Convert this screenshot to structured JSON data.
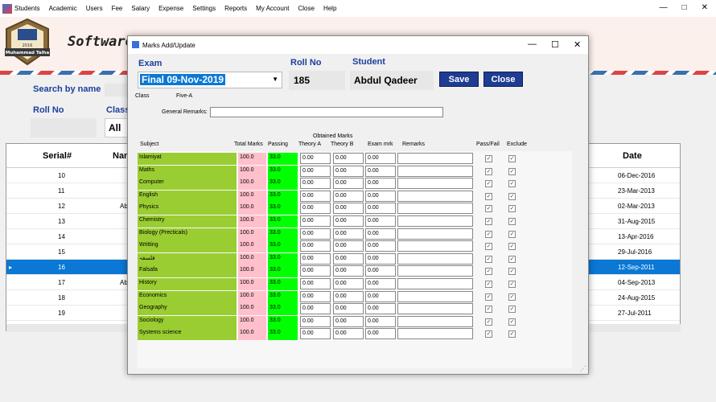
{
  "menu": [
    "Students",
    "Academic",
    "Users",
    "Fee",
    "Salary",
    "Expense",
    "Settings",
    "Reports",
    "My Account",
    "Close",
    "Help"
  ],
  "window_controls": [
    "—",
    "□",
    "✕"
  ],
  "banner": {
    "software_title": "Software",
    "logo_text": "Muhammad Talha",
    "logo_year": "2016"
  },
  "main": {
    "search_label": "Search by name",
    "roll_label": "Roll No",
    "class_label": "Class",
    "class_value": "All"
  },
  "grid": {
    "headers": {
      "serial": "Serial#",
      "name": "Nam",
      "date": "Date"
    },
    "rows": [
      {
        "serial": "10",
        "name": "",
        "date": "06-Dec-2016"
      },
      {
        "serial": "11",
        "name": "",
        "date": "23-Mar-2013"
      },
      {
        "serial": "12",
        "name": "Ab",
        "date": "02-Mar-2013"
      },
      {
        "serial": "13",
        "name": "",
        "date": "31-Aug-2015"
      },
      {
        "serial": "14",
        "name": "",
        "date": "13-Apr-2016"
      },
      {
        "serial": "15",
        "name": "",
        "date": "29-Jul-2016"
      },
      {
        "serial": "16",
        "name": "",
        "date": "12-Sep-2011"
      },
      {
        "serial": "17",
        "name": "Ab",
        "date": "04-Sep-2013"
      },
      {
        "serial": "18",
        "name": "",
        "date": "24-Aug-2015"
      },
      {
        "serial": "19",
        "name": "",
        "date": "27-Jul-2011"
      }
    ],
    "selected_index": 6,
    "selected_marker": "▸"
  },
  "dialog": {
    "title": "Marks Add/Update",
    "controls": [
      "—",
      "☐",
      "✕"
    ],
    "exam_label": "Exam",
    "exam_value": "Final 09-Nov-2019",
    "roll_label": "Roll No",
    "roll_value": "185",
    "student_label": "Student",
    "student_value": "Abdul Qadeer",
    "save_label": "Save",
    "close_label": "Close",
    "class_label": "Class",
    "class_value": "Five-A",
    "remarks_label": "General Remarks:",
    "headers": {
      "subject": "Subject",
      "total": "Total Marks",
      "passing": "Passing",
      "obtained": "Obtained Marks",
      "theory_a": "Theory A",
      "theory_b": "Theory B",
      "exam_mrk": "Exam mrk",
      "remarks": "Remarks",
      "pass_fail": "Pass/Fail",
      "exclude": "Exclude"
    },
    "subjects": [
      {
        "name": "Islamiyat",
        "total": "100.0",
        "passing": "33.0",
        "a": "0.00",
        "b": "0.00",
        "e": "0.00"
      },
      {
        "name": "Maths",
        "total": "100.0",
        "passing": "33.0",
        "a": "0.00",
        "b": "0.00",
        "e": "0.00"
      },
      {
        "name": "Computer",
        "total": "100.0",
        "passing": "33.0",
        "a": "0.00",
        "b": "0.00",
        "e": "0.00"
      },
      {
        "name": "English",
        "total": "100.0",
        "passing": "33.0",
        "a": "0.00",
        "b": "0.00",
        "e": "0.00"
      },
      {
        "name": "Physics",
        "total": "100.0",
        "passing": "33.0",
        "a": "0.00",
        "b": "0.00",
        "e": "0.00"
      },
      {
        "name": "Chemistry",
        "total": "100.0",
        "passing": "33.0",
        "a": "0.00",
        "b": "0.00",
        "e": "0.00"
      },
      {
        "name": "Biology (Precticals)",
        "total": "100.0",
        "passing": "33.0",
        "a": "0.00",
        "b": "0.00",
        "e": "0.00"
      },
      {
        "name": "Writting",
        "total": "100.0",
        "passing": "33.0",
        "a": "0.00",
        "b": "0.00",
        "e": "0.00"
      },
      {
        "name": "فلسفہ",
        "total": "100.0",
        "passing": "33.0",
        "a": "0.00",
        "b": "0.00",
        "e": "0.00"
      },
      {
        "name": "Falsafa",
        "total": "100.0",
        "passing": "33.0",
        "a": "0.00",
        "b": "0.00",
        "e": "0.00"
      },
      {
        "name": "History",
        "total": "100.0",
        "passing": "33.0",
        "a": "0.00",
        "b": "0.00",
        "e": "0.00"
      },
      {
        "name": "Economics",
        "total": "100.0",
        "passing": "33.0",
        "a": "0.00",
        "b": "0.00",
        "e": "0.00"
      },
      {
        "name": "Geography",
        "total": "100.0",
        "passing": "33.0",
        "a": "0.00",
        "b": "0.00",
        "e": "0.00"
      },
      {
        "name": "Sociology",
        "total": "100.0",
        "passing": "33.0",
        "a": "0.00",
        "b": "0.00",
        "e": "0.00"
      },
      {
        "name": "Systems science",
        "total": "100.0",
        "passing": "33.0",
        "a": "0.00",
        "b": "0.00",
        "e": "0.00"
      }
    ],
    "check_glyph": "✓"
  },
  "colors": {
    "accent": "#1d3c92",
    "label_blue": "#1b3f9a",
    "selection": "#0a78d4",
    "subject_bg": "#9acd32",
    "total_bg": "#ffc0cb",
    "passing_bg": "#00ff00"
  }
}
